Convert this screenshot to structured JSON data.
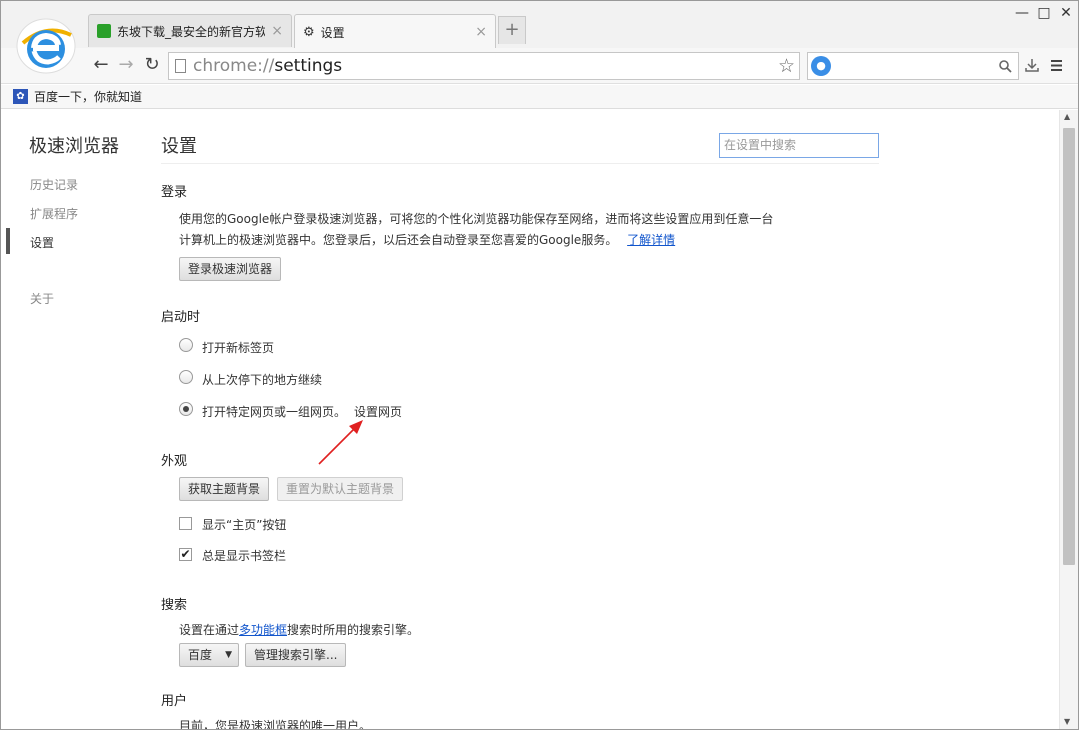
{
  "tabs": [
    {
      "title": "东坡下载_最安全的新官方软",
      "close": "×"
    },
    {
      "title": "设置",
      "close": "×"
    }
  ],
  "new_tab": "+",
  "window_controls": {
    "minimize": "—",
    "maximize": "□",
    "close": "✕"
  },
  "toolbar": {
    "back": "←",
    "forward": "→",
    "reload": "↻"
  },
  "omnibox": {
    "scheme": "chrome://",
    "path": "settings",
    "star": "☆"
  },
  "bookmarks": [
    {
      "label": "百度一下，你就知道"
    }
  ],
  "sidebar": {
    "title": "极速浏览器",
    "items": [
      {
        "label": "历史记录"
      },
      {
        "label": "扩展程序"
      },
      {
        "label": "设置"
      },
      {
        "label": "关于"
      }
    ]
  },
  "settings": {
    "title": "设置",
    "search_placeholder": "在设置中搜索",
    "signin": {
      "heading": "登录",
      "desc_line1": "使用您的Google帐户登录极速浏览器，可将您的个性化浏览器功能保存至网络，进而将这些设置应用到任意一台",
      "desc_line2": "计算机上的极速浏览器中。您登录后，以后还会自动登录至您喜爱的Google服务。",
      "learn_more": "了解详情",
      "button": "登录极速浏览器"
    },
    "startup": {
      "heading": "启动时",
      "options": [
        {
          "label": "打开新标签页",
          "checked": false
        },
        {
          "label": "从上次停下的地方继续",
          "checked": false
        },
        {
          "label": "打开特定网页或一组网页。",
          "checked": true
        }
      ],
      "set_pages_link": "设置网页"
    },
    "appearance": {
      "heading": "外观",
      "get_themes": "获取主题背景",
      "reset_theme": "重置为默认主题背景",
      "show_home": {
        "label": "显示“主页”按钮",
        "checked": false
      },
      "show_bookmarks": {
        "label": "总是显示书签栏",
        "checked": true
      }
    },
    "search": {
      "heading": "搜索",
      "desc_prefix": "设置在通过",
      "desc_link": "多功能框",
      "desc_suffix": "搜索时所用的搜索引擎。",
      "engine": "百度",
      "manage": "管理搜索引擎..."
    },
    "users": {
      "heading": "用户",
      "desc": "目前，您是极速浏览器的唯一用户。"
    }
  },
  "colors": {
    "accent": "#1155cc",
    "arrow": "#e02020"
  }
}
